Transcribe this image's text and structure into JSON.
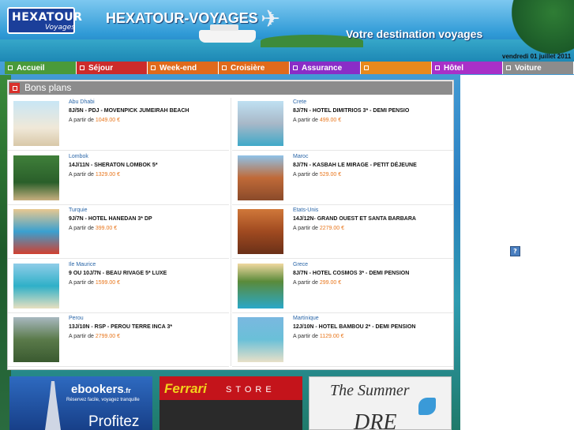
{
  "header": {
    "logo": {
      "name": "HEXATOUR",
      "sub": "Voyages"
    },
    "site_title": "HEXATOUR-VOYAGES",
    "tagline": "Votre destination voyages",
    "date": "vendredi 01 juillet 2011"
  },
  "nav": {
    "items": [
      {
        "label": "Accueil",
        "color": "#4a9a3a"
      },
      {
        "label": "Séjour",
        "color": "#cc2b2b"
      },
      {
        "label": "Week-end",
        "color": "#e06a1c"
      },
      {
        "label": "Croisière",
        "color": "#e06a1c"
      },
      {
        "label": "Assurance",
        "color": "#8a2dc7"
      },
      {
        "label": "",
        "color": "#e8891c"
      },
      {
        "label": "Hôtel",
        "color": "#a830c8"
      },
      {
        "label": "Voiture",
        "color": "#8c8c8c"
      }
    ]
  },
  "bons_plans": {
    "title": "Bons plans",
    "price_prefix": "A partir de",
    "deals": [
      {
        "destination": "Abu Dhabi",
        "title": "8J/5N - PDJ - MOVENPICK JUMEIRAH BEACH",
        "price": "1049.00 €",
        "image": "beach-chairs-photo"
      },
      {
        "destination": "Crete",
        "title": "8J/7N - HOTEL DIMITRIOS 3* - DEMI PENSIO",
        "price": "499.00 €",
        "image": "hotel-pool-photo"
      },
      {
        "destination": "Lombok",
        "title": "14J/11N - SHERATON LOMBOK 5*",
        "price": "1329.00 €",
        "image": "tropical-resort-photo"
      },
      {
        "destination": "Maroc",
        "title": "8J/7N - KASBAH LE MIRAGE - PETIT DÉJEUNE",
        "price": "529.00 €",
        "image": "kasbah-photo"
      },
      {
        "destination": "Turquie",
        "title": "9J/7N - HOTEL HANEDAN 3* DP",
        "price": "399.00 €",
        "image": "pool-deck-photo"
      },
      {
        "destination": "Etats-Unis",
        "title": "14J/12N- GRAND OUEST ET SANTA BARBARA",
        "price": "2279.00 €",
        "image": "canyon-photo"
      },
      {
        "destination": "Ile Maurice",
        "title": "9 OU 10J/7N - BEAU RIVAGE 5* LUXE",
        "price": "1599.00 €",
        "image": "lagoon-photo"
      },
      {
        "destination": "Grece",
        "title": "8J/7N - HOTEL COSMOS 3* - DEMI PENSION",
        "price": "299.00 €",
        "image": "resort-pool-photo"
      },
      {
        "destination": "Perou",
        "title": "13J/10N - RSP - PEROU TERRE INCA 3*",
        "price": "2799.00 €",
        "image": "machu-picchu-photo"
      },
      {
        "destination": "Martinique",
        "title": "12J/10N - HOTEL BAMBOU 2* - DEMI PENSION",
        "price": "1129.00 €",
        "image": "beach-umbrella-photo"
      }
    ]
  },
  "ads": {
    "ebookers": {
      "brand": "ebookers",
      "suffix": ".fr",
      "tagline": "Réservez facile, voyagez tranquille",
      "cta": "Profitez"
    },
    "ferrari": {
      "brand": "Ferrari",
      "store": "STORE"
    },
    "summer": {
      "line1": "The Summer",
      "line2": "DRE"
    }
  },
  "misc": {
    "help_icon": "?"
  }
}
